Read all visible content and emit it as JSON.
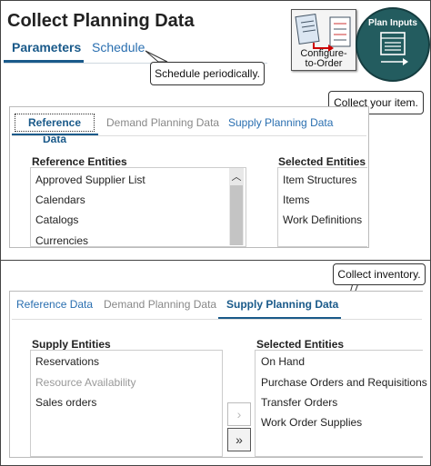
{
  "page": {
    "title": "Collect Planning Data"
  },
  "top_tabs": [
    {
      "label": "Parameters",
      "active": true
    },
    {
      "label": "Schedule",
      "active": false
    }
  ],
  "callouts": {
    "schedule": "Schedule periodically.",
    "collect_item": "Collect your item.",
    "collect_inventory": "Collect inventory."
  },
  "icons": {
    "configure_to_order": "Configure-\nto-Order",
    "plan_inputs": "Plan Inputs"
  },
  "panel1": {
    "tabs": [
      "Reference Data",
      "Demand Planning Data",
      "Supply Planning Data"
    ],
    "active_tab": "Reference Data",
    "left_label": "Reference Entities",
    "left_items": [
      "Approved Supplier List",
      "Calendars",
      "Catalogs",
      "Currencies"
    ],
    "right_label": "Selected Entities",
    "right_items": [
      "Item Structures",
      "Items",
      "Work Definitions"
    ]
  },
  "panel2": {
    "tabs": [
      "Reference Data",
      "Demand Planning Data",
      "Supply Planning Data"
    ],
    "active_tab": "Supply Planning Data",
    "left_label": "Supply Entities",
    "left_items": [
      "Reservations",
      "Resource Availability",
      "Sales orders"
    ],
    "right_label": "Selected Entities",
    "right_items": [
      "On Hand",
      "Purchase Orders and Requisitions",
      "Transfer Orders",
      "Work Order Supplies"
    ],
    "move_buttons": {
      "move_one": "›",
      "move_all": "»"
    }
  },
  "colors": {
    "accent": "#1a5a8a",
    "link": "#2a6fb0",
    "teal": "#235c5f"
  }
}
